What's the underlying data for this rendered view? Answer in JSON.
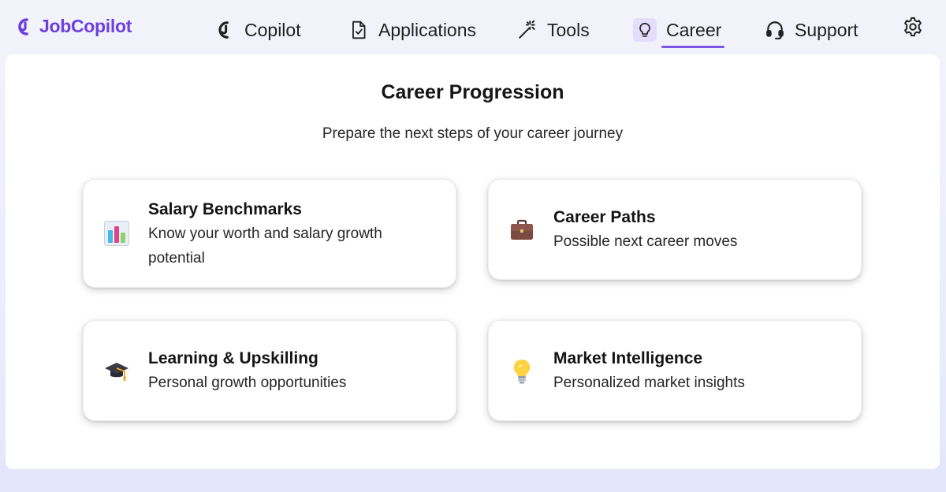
{
  "brand": {
    "name": "JobCopilot",
    "color": "#6b3fe0"
  },
  "nav": {
    "items": [
      {
        "label": "Copilot",
        "icon": "copilot-icon"
      },
      {
        "label": "Applications",
        "icon": "document-check-icon"
      },
      {
        "label": "Tools",
        "icon": "magic-wand-icon"
      },
      {
        "label": "Career",
        "icon": "lightbulb-icon",
        "active": true
      },
      {
        "label": "Support",
        "icon": "headset-icon"
      }
    ],
    "settings_icon": "gear-icon",
    "accent": "#7c55e6"
  },
  "page": {
    "title": "Career Progression",
    "subtitle": "Prepare the next steps of your career journey"
  },
  "cards": [
    {
      "title": "Salary Benchmarks",
      "description": "Know your worth and salary growth potential",
      "icon": "bar-chart-icon"
    },
    {
      "title": "Career Paths",
      "description": "Possible next career moves",
      "icon": "briefcase-icon"
    },
    {
      "title": "Learning & Upskilling",
      "description": "Personal growth opportunities",
      "icon": "graduation-cap-icon"
    },
    {
      "title": "Market Intelligence",
      "description": "Personalized market insights",
      "icon": "lightbulb-icon"
    }
  ]
}
